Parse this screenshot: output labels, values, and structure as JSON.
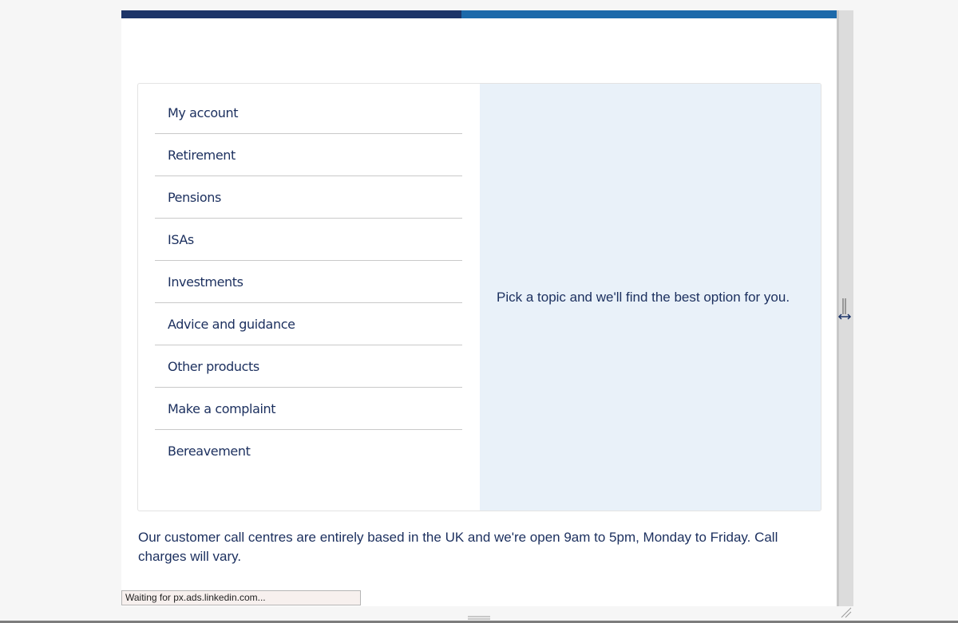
{
  "colors": {
    "topbar_dark": "#1c3468",
    "topbar_light": "#1c69aa",
    "menu_text": "#1b2f5e",
    "panel_bg": "#e9f1f9",
    "body_text": "#1b2f5e"
  },
  "menu": {
    "items": [
      {
        "label": "My account"
      },
      {
        "label": "Retirement"
      },
      {
        "label": "Pensions"
      },
      {
        "label": "ISAs"
      },
      {
        "label": "Investments"
      },
      {
        "label": "Advice and guidance"
      },
      {
        "label": "Other products"
      },
      {
        "label": "Make a complaint"
      },
      {
        "label": "Bereavement"
      }
    ]
  },
  "panel": {
    "message": "Pick a topic and we'll find the best option for you."
  },
  "footer": {
    "note": "Our customer call centres are entirely based in the UK and we're open 9am to 5pm, Monday to Friday. Call charges will vary."
  },
  "status": {
    "text": "Waiting for px.ads.linkedin.com..."
  },
  "icons": {
    "resize": "resize-horizontal-icon",
    "grip": "drag-grip-icon",
    "corner": "corner-resize-icon"
  }
}
